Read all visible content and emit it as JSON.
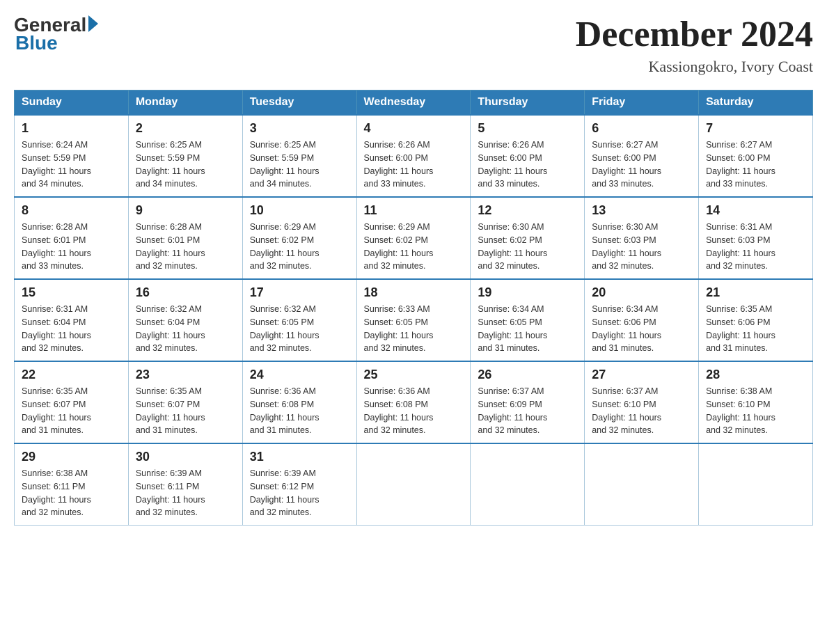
{
  "header": {
    "logo_general": "General",
    "logo_blue": "Blue",
    "title": "December 2024",
    "subtitle": "Kassiongokro, Ivory Coast"
  },
  "days_of_week": [
    "Sunday",
    "Monday",
    "Tuesday",
    "Wednesday",
    "Thursday",
    "Friday",
    "Saturday"
  ],
  "weeks": [
    [
      {
        "day": "1",
        "sunrise": "6:24 AM",
        "sunset": "5:59 PM",
        "daylight": "11 hours and 34 minutes."
      },
      {
        "day": "2",
        "sunrise": "6:25 AM",
        "sunset": "5:59 PM",
        "daylight": "11 hours and 34 minutes."
      },
      {
        "day": "3",
        "sunrise": "6:25 AM",
        "sunset": "5:59 PM",
        "daylight": "11 hours and 34 minutes."
      },
      {
        "day": "4",
        "sunrise": "6:26 AM",
        "sunset": "6:00 PM",
        "daylight": "11 hours and 33 minutes."
      },
      {
        "day": "5",
        "sunrise": "6:26 AM",
        "sunset": "6:00 PM",
        "daylight": "11 hours and 33 minutes."
      },
      {
        "day": "6",
        "sunrise": "6:27 AM",
        "sunset": "6:00 PM",
        "daylight": "11 hours and 33 minutes."
      },
      {
        "day": "7",
        "sunrise": "6:27 AM",
        "sunset": "6:00 PM",
        "daylight": "11 hours and 33 minutes."
      }
    ],
    [
      {
        "day": "8",
        "sunrise": "6:28 AM",
        "sunset": "6:01 PM",
        "daylight": "11 hours and 33 minutes."
      },
      {
        "day": "9",
        "sunrise": "6:28 AM",
        "sunset": "6:01 PM",
        "daylight": "11 hours and 32 minutes."
      },
      {
        "day": "10",
        "sunrise": "6:29 AM",
        "sunset": "6:02 PM",
        "daylight": "11 hours and 32 minutes."
      },
      {
        "day": "11",
        "sunrise": "6:29 AM",
        "sunset": "6:02 PM",
        "daylight": "11 hours and 32 minutes."
      },
      {
        "day": "12",
        "sunrise": "6:30 AM",
        "sunset": "6:02 PM",
        "daylight": "11 hours and 32 minutes."
      },
      {
        "day": "13",
        "sunrise": "6:30 AM",
        "sunset": "6:03 PM",
        "daylight": "11 hours and 32 minutes."
      },
      {
        "day": "14",
        "sunrise": "6:31 AM",
        "sunset": "6:03 PM",
        "daylight": "11 hours and 32 minutes."
      }
    ],
    [
      {
        "day": "15",
        "sunrise": "6:31 AM",
        "sunset": "6:04 PM",
        "daylight": "11 hours and 32 minutes."
      },
      {
        "day": "16",
        "sunrise": "6:32 AM",
        "sunset": "6:04 PM",
        "daylight": "11 hours and 32 minutes."
      },
      {
        "day": "17",
        "sunrise": "6:32 AM",
        "sunset": "6:05 PM",
        "daylight": "11 hours and 32 minutes."
      },
      {
        "day": "18",
        "sunrise": "6:33 AM",
        "sunset": "6:05 PM",
        "daylight": "11 hours and 32 minutes."
      },
      {
        "day": "19",
        "sunrise": "6:34 AM",
        "sunset": "6:05 PM",
        "daylight": "11 hours and 31 minutes."
      },
      {
        "day": "20",
        "sunrise": "6:34 AM",
        "sunset": "6:06 PM",
        "daylight": "11 hours and 31 minutes."
      },
      {
        "day": "21",
        "sunrise": "6:35 AM",
        "sunset": "6:06 PM",
        "daylight": "11 hours and 31 minutes."
      }
    ],
    [
      {
        "day": "22",
        "sunrise": "6:35 AM",
        "sunset": "6:07 PM",
        "daylight": "11 hours and 31 minutes."
      },
      {
        "day": "23",
        "sunrise": "6:35 AM",
        "sunset": "6:07 PM",
        "daylight": "11 hours and 31 minutes."
      },
      {
        "day": "24",
        "sunrise": "6:36 AM",
        "sunset": "6:08 PM",
        "daylight": "11 hours and 31 minutes."
      },
      {
        "day": "25",
        "sunrise": "6:36 AM",
        "sunset": "6:08 PM",
        "daylight": "11 hours and 32 minutes."
      },
      {
        "day": "26",
        "sunrise": "6:37 AM",
        "sunset": "6:09 PM",
        "daylight": "11 hours and 32 minutes."
      },
      {
        "day": "27",
        "sunrise": "6:37 AM",
        "sunset": "6:10 PM",
        "daylight": "11 hours and 32 minutes."
      },
      {
        "day": "28",
        "sunrise": "6:38 AM",
        "sunset": "6:10 PM",
        "daylight": "11 hours and 32 minutes."
      }
    ],
    [
      {
        "day": "29",
        "sunrise": "6:38 AM",
        "sunset": "6:11 PM",
        "daylight": "11 hours and 32 minutes."
      },
      {
        "day": "30",
        "sunrise": "6:39 AM",
        "sunset": "6:11 PM",
        "daylight": "11 hours and 32 minutes."
      },
      {
        "day": "31",
        "sunrise": "6:39 AM",
        "sunset": "6:12 PM",
        "daylight": "11 hours and 32 minutes."
      },
      null,
      null,
      null,
      null
    ]
  ],
  "labels": {
    "sunrise": "Sunrise:",
    "sunset": "Sunset:",
    "daylight": "Daylight:"
  }
}
